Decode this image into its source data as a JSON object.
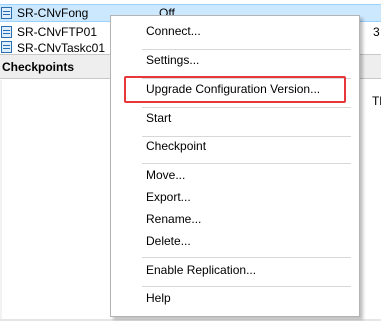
{
  "vm_list": {
    "rows": [
      {
        "name": "SR-CNvFong",
        "state": "Off"
      },
      {
        "name": "SR-CNvFTP01",
        "state": ""
      },
      {
        "name": "SR-CNvTaskc01",
        "state": ""
      }
    ],
    "edge_right_top": "3",
    "edge_right_mid": "Th"
  },
  "panel": {
    "title": "Checkpoints"
  },
  "context_menu": {
    "items": [
      {
        "label": "Connect..."
      },
      {
        "label": "Settings..."
      },
      {
        "label": "Upgrade Configuration Version..."
      },
      {
        "label": "Start"
      },
      {
        "label": "Checkpoint"
      },
      {
        "label": "Move..."
      },
      {
        "label": "Export..."
      },
      {
        "label": "Rename..."
      },
      {
        "label": "Delete..."
      },
      {
        "label": "Enable Replication..."
      },
      {
        "label": "Help"
      }
    ]
  },
  "colors": {
    "selection": "#cce8ff",
    "highlight_box": "#e8373a"
  }
}
